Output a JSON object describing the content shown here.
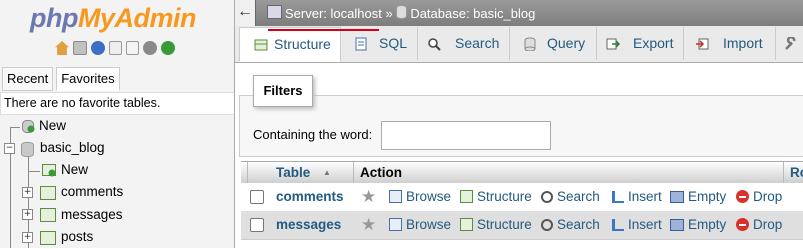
{
  "logo": {
    "part1": "php",
    "part2": "MyAdmin"
  },
  "nav": {
    "icons": [
      "home-icon",
      "exit-icon",
      "help-icon",
      "docs-icon",
      "copy-icon",
      "gear-icon",
      "reload-icon"
    ],
    "tabs": [
      "Recent",
      "Favorites"
    ],
    "favorites_empty": "There are no favorite tables.",
    "tree": {
      "root_new": "New",
      "database": "basic_blog",
      "db_new": "New",
      "tables": [
        "comments",
        "messages",
        "posts"
      ]
    }
  },
  "topbar": {
    "collapse": "←",
    "server": "Server: localhost",
    "separator": "»",
    "database": "Database: basic_blog"
  },
  "tabs": [
    {
      "label": "Structure",
      "icon": "structure-icon"
    },
    {
      "label": "SQL",
      "icon": "sql-icon"
    },
    {
      "label": "Search",
      "icon": "search-icon"
    },
    {
      "label": "Query",
      "icon": "query-icon"
    },
    {
      "label": "Export",
      "icon": "export-icon"
    },
    {
      "label": "Import",
      "icon": "import-icon"
    },
    {
      "label": "",
      "icon": "wrench-icon"
    }
  ],
  "filters": {
    "legend": "Filters",
    "label": "Containing the word:",
    "value": ""
  },
  "table": {
    "headers": {
      "table": "Table",
      "sort": "▲",
      "action": "Action",
      "rows": "Ro"
    },
    "rows": [
      {
        "name": "comments",
        "actions": [
          "Browse",
          "Structure",
          "Search",
          "Insert",
          "Empty",
          "Drop"
        ]
      },
      {
        "name": "messages",
        "actions": [
          "Browse",
          "Structure",
          "Search",
          "Insert",
          "Empty",
          "Drop"
        ]
      }
    ]
  },
  "colors": {
    "link": "#235a81",
    "logo_php": "#6c78af",
    "logo_myadmin": "#f8981d",
    "highlight": "#d4001b"
  }
}
